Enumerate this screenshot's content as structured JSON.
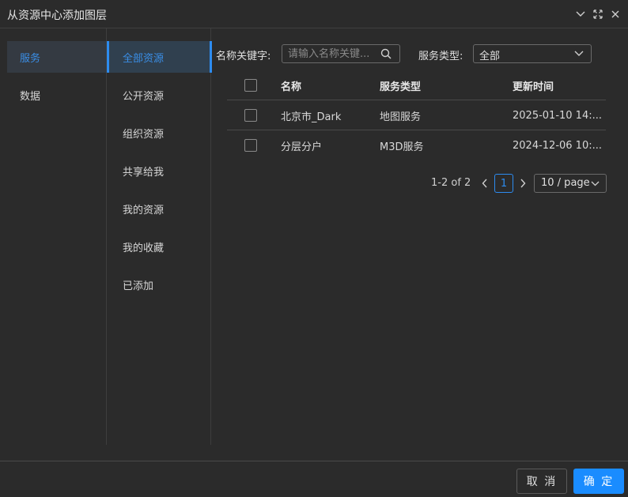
{
  "window": {
    "title": "从资源中心添加图层"
  },
  "sidebar_primary": {
    "items": [
      {
        "label": "服务",
        "active": true
      },
      {
        "label": "数据",
        "active": false
      }
    ]
  },
  "sidebar_secondary": {
    "items": [
      {
        "label": "全部资源",
        "active": true
      },
      {
        "label": "公开资源",
        "active": false
      },
      {
        "label": "组织资源",
        "active": false
      },
      {
        "label": "共享给我",
        "active": false
      },
      {
        "label": "我的资源",
        "active": false
      },
      {
        "label": "我的收藏",
        "active": false
      },
      {
        "label": "已添加",
        "active": false
      }
    ]
  },
  "filters": {
    "keyword_label": "名称关键字:",
    "keyword_placeholder": "请输入名称关键...",
    "keyword_value": "",
    "type_label": "服务类型:",
    "type_value": "全部"
  },
  "table": {
    "columns": [
      "名称",
      "服务类型",
      "更新时间"
    ],
    "rows": [
      {
        "name": "北京市_Dark",
        "type": "地图服务",
        "time": "2025-01-10 14:..."
      },
      {
        "name": "分层分户",
        "type": "M3D服务",
        "time": "2024-12-06 10:..."
      }
    ]
  },
  "pagination": {
    "total_text": "1-2 of 2",
    "current_page": "1",
    "page_size": "10 / page"
  },
  "footer": {
    "cancel_label": "取 消",
    "ok_label": "确 定"
  },
  "colors": {
    "background": "#2b2b2b",
    "accent": "#2d8cf0",
    "primary_button": "#1a8cff"
  },
  "icons": {
    "minimize": "chevron-down-icon",
    "fullscreen": "expand-icon",
    "close": "close-icon",
    "search": "search-icon",
    "dropdown": "chevron-down-icon",
    "prev": "chevron-left-icon",
    "next": "chevron-right-icon"
  }
}
